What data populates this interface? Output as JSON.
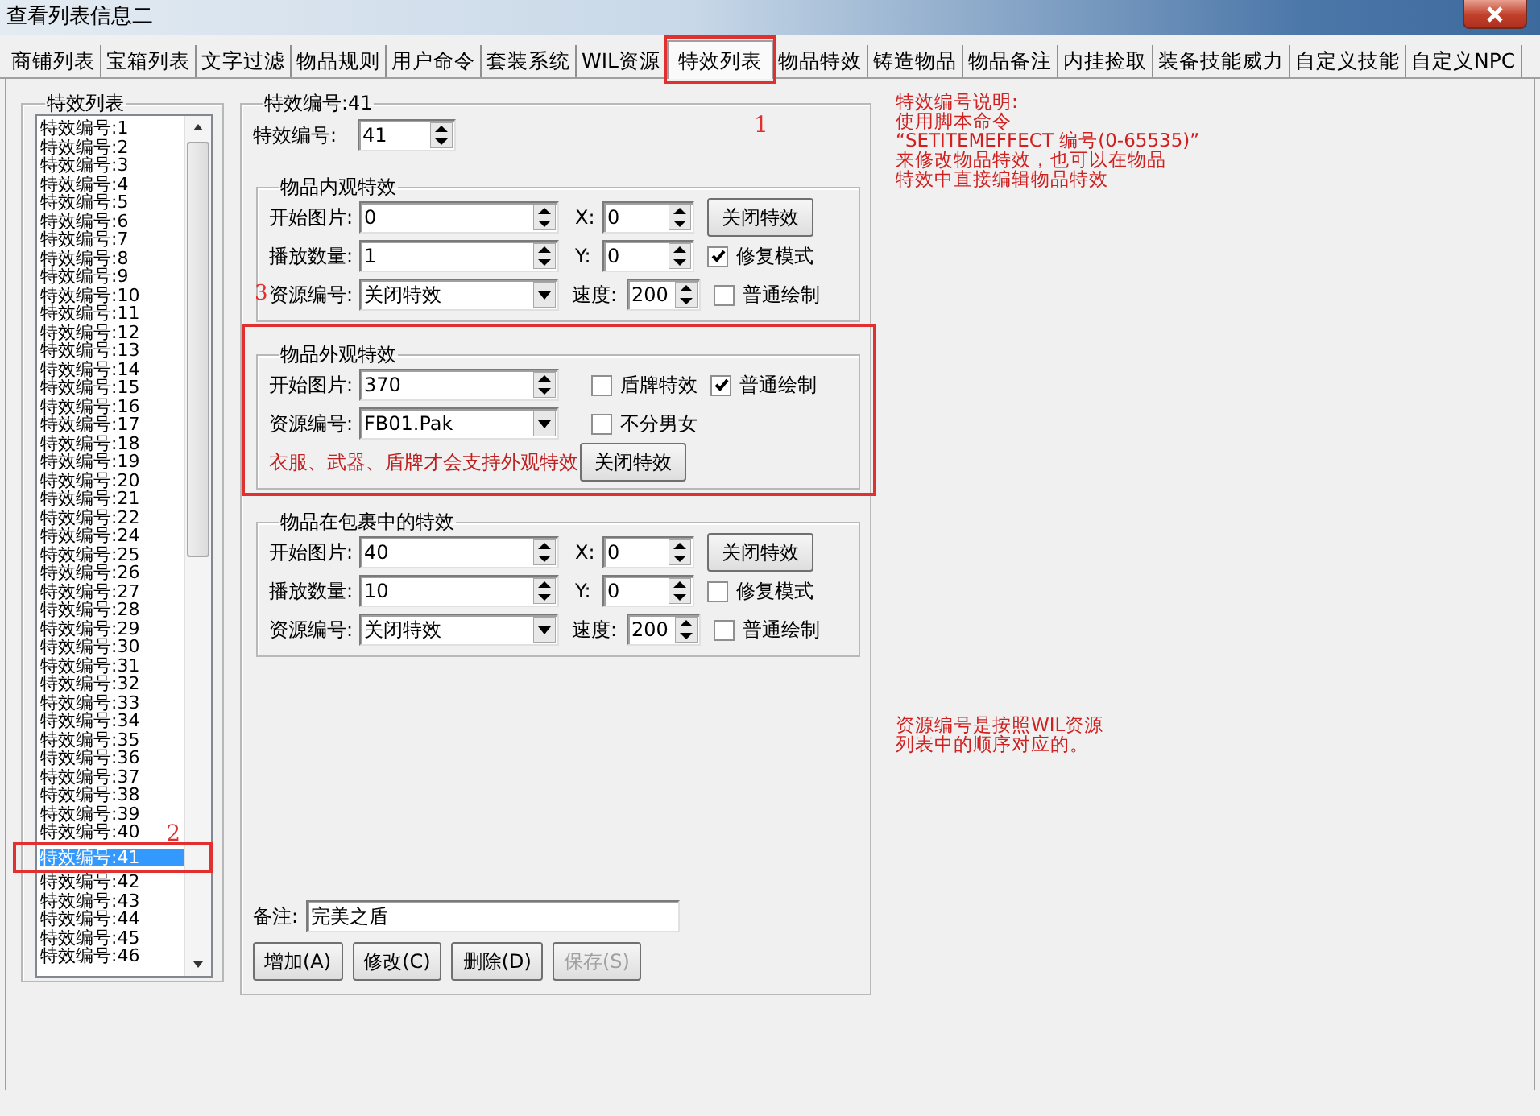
{
  "window": {
    "title": "查看列表信息二"
  },
  "tabs": [
    {
      "label": "商铺列表",
      "selected": false,
      "highlighted": false
    },
    {
      "label": "宝箱列表",
      "selected": false,
      "highlighted": false
    },
    {
      "label": "文字过滤",
      "selected": false,
      "highlighted": false
    },
    {
      "label": "物品规则",
      "selected": false,
      "highlighted": false
    },
    {
      "label": "用户命令",
      "selected": false,
      "highlighted": false
    },
    {
      "label": "套装系统",
      "selected": false,
      "highlighted": false
    },
    {
      "label": "WIL资源",
      "selected": false,
      "highlighted": false
    },
    {
      "label": "特效列表",
      "selected": true,
      "highlighted": true
    },
    {
      "label": "物品特效",
      "selected": false,
      "highlighted": false
    },
    {
      "label": "铸造物品",
      "selected": false,
      "highlighted": false
    },
    {
      "label": "物品备注",
      "selected": false,
      "highlighted": false
    },
    {
      "label": "内挂捡取",
      "selected": false,
      "highlighted": false
    },
    {
      "label": "装备技能威力",
      "selected": false,
      "highlighted": false
    },
    {
      "label": "自定义技能",
      "selected": false,
      "highlighted": false
    },
    {
      "label": "自定义NPC",
      "selected": false,
      "highlighted": false
    }
  ],
  "effect_list": {
    "title": "特效列表",
    "items": [
      {
        "label": "特效编号:1",
        "selected": false,
        "highlighted": false
      },
      {
        "label": "特效编号:2",
        "selected": false,
        "highlighted": false
      },
      {
        "label": "特效编号:3",
        "selected": false,
        "highlighted": false
      },
      {
        "label": "特效编号:4",
        "selected": false,
        "highlighted": false
      },
      {
        "label": "特效编号:5",
        "selected": false,
        "highlighted": false
      },
      {
        "label": "特效编号:6",
        "selected": false,
        "highlighted": false
      },
      {
        "label": "特效编号:7",
        "selected": false,
        "highlighted": false
      },
      {
        "label": "特效编号:8",
        "selected": false,
        "highlighted": false
      },
      {
        "label": "特效编号:9",
        "selected": false,
        "highlighted": false
      },
      {
        "label": "特效编号:10",
        "selected": false,
        "highlighted": false
      },
      {
        "label": "特效编号:11",
        "selected": false,
        "highlighted": false
      },
      {
        "label": "特效编号:12",
        "selected": false,
        "highlighted": false
      },
      {
        "label": "特效编号:13",
        "selected": false,
        "highlighted": false
      },
      {
        "label": "特效编号:14",
        "selected": false,
        "highlighted": false
      },
      {
        "label": "特效编号:15",
        "selected": false,
        "highlighted": false
      },
      {
        "label": "特效编号:16",
        "selected": false,
        "highlighted": false
      },
      {
        "label": "特效编号:17",
        "selected": false,
        "highlighted": false
      },
      {
        "label": "特效编号:18",
        "selected": false,
        "highlighted": false
      },
      {
        "label": "特效编号:19",
        "selected": false,
        "highlighted": false
      },
      {
        "label": "特效编号:20",
        "selected": false,
        "highlighted": false
      },
      {
        "label": "特效编号:21",
        "selected": false,
        "highlighted": false
      },
      {
        "label": "特效编号:22",
        "selected": false,
        "highlighted": false
      },
      {
        "label": "特效编号:24",
        "selected": false,
        "highlighted": false
      },
      {
        "label": "特效编号:25",
        "selected": false,
        "highlighted": false
      },
      {
        "label": "特效编号:26",
        "selected": false,
        "highlighted": false
      },
      {
        "label": "特效编号:27",
        "selected": false,
        "highlighted": false
      },
      {
        "label": "特效编号:28",
        "selected": false,
        "highlighted": false
      },
      {
        "label": "特效编号:29",
        "selected": false,
        "highlighted": false
      },
      {
        "label": "特效编号:30",
        "selected": false,
        "highlighted": false
      },
      {
        "label": "特效编号:31",
        "selected": false,
        "highlighted": false
      },
      {
        "label": "特效编号:32",
        "selected": false,
        "highlighted": false
      },
      {
        "label": "特效编号:33",
        "selected": false,
        "highlighted": false
      },
      {
        "label": "特效编号:34",
        "selected": false,
        "highlighted": false
      },
      {
        "label": "特效编号:35",
        "selected": false,
        "highlighted": false
      },
      {
        "label": "特效编号:36",
        "selected": false,
        "highlighted": false
      },
      {
        "label": "特效编号:37",
        "selected": false,
        "highlighted": false
      },
      {
        "label": "特效编号:38",
        "selected": false,
        "highlighted": false
      },
      {
        "label": "特效编号:39",
        "selected": false,
        "highlighted": false
      },
      {
        "label": "特效编号:40",
        "selected": false,
        "highlighted": false
      },
      {
        "label": "特效编号:41",
        "selected": true,
        "highlighted": true
      },
      {
        "label": "特效编号:42",
        "selected": false,
        "highlighted": false
      },
      {
        "label": "特效编号:43",
        "selected": false,
        "highlighted": false
      },
      {
        "label": "特效编号:44",
        "selected": false,
        "highlighted": false
      },
      {
        "label": "特效编号:45",
        "selected": false,
        "highlighted": false
      },
      {
        "label": "特效编号:46",
        "selected": false,
        "highlighted": false
      }
    ]
  },
  "details": {
    "title": "特效编号:41",
    "id_label": "特效编号:",
    "id_value": "41",
    "groups": [
      {
        "kind": "standard",
        "title": "物品内观特效",
        "highlighted": false,
        "start_label": "开始图片:",
        "start_value": "0",
        "x_label": "X:",
        "x_value": "0",
        "close_button": "关闭特效",
        "count_label": "播放数量:",
        "count_value": "1",
        "y_label": "Y:",
        "y_value": "0",
        "repair": {
          "label": "修复模式",
          "checked": true
        },
        "source_label": "资源编号:",
        "source_value": "关闭特效",
        "speed_label": "速度:",
        "speed_value": "200",
        "normal": {
          "label": "普通绘制",
          "checked": false
        }
      },
      {
        "kind": "appearance",
        "title": "物品外观特效",
        "highlighted": true,
        "start_label": "开始图片:",
        "start_value": "370",
        "shield": {
          "label": "盾牌特效",
          "checked": false
        },
        "normal": {
          "label": "普通绘制",
          "checked": true
        },
        "source_label": "资源编号:",
        "source_value": "FB01.Pak",
        "unisex": {
          "label": "不分男女",
          "checked": false
        },
        "note": "衣服、武器、盾牌才会支持外观特效",
        "close_button": "关闭特效"
      },
      {
        "kind": "standard",
        "title": "物品在包裹中的特效",
        "highlighted": false,
        "start_label": "开始图片:",
        "start_value": "40",
        "x_label": "X:",
        "x_value": "0",
        "close_button": "关闭特效",
        "count_label": "播放数量:",
        "count_value": "10",
        "y_label": "Y:",
        "y_value": "0",
        "repair": {
          "label": "修复模式",
          "checked": false
        },
        "source_label": "资源编号:",
        "source_value": "关闭特效",
        "speed_label": "速度:",
        "speed_value": "200",
        "normal": {
          "label": "普通绘制",
          "checked": false
        }
      }
    ],
    "remark_label": "备注:",
    "remark_value": "完美之盾",
    "buttons": [
      {
        "label": "增加(A)",
        "disabled": false
      },
      {
        "label": "修改(C)",
        "disabled": false
      },
      {
        "label": "删除(D)",
        "disabled": false
      },
      {
        "label": "保存(S)",
        "disabled": true
      }
    ]
  },
  "help_notes": [
    {
      "lines": [
        "特效编号说明:",
        "使用脚本命令",
        "“SETITEMEFFECT  编号(0-65535)”",
        "来修改物品特效，也可以在物品",
        "特效中直接编辑物品特效"
      ]
    },
    {
      "lines": [
        "资源编号是按照WIL资源",
        "列表中的顺序对应的。"
      ]
    }
  ],
  "markers": [
    {
      "kind": "tab",
      "label": "1"
    },
    {
      "kind": "list",
      "label": "2"
    },
    {
      "kind": "source-row",
      "label": "3"
    }
  ]
}
